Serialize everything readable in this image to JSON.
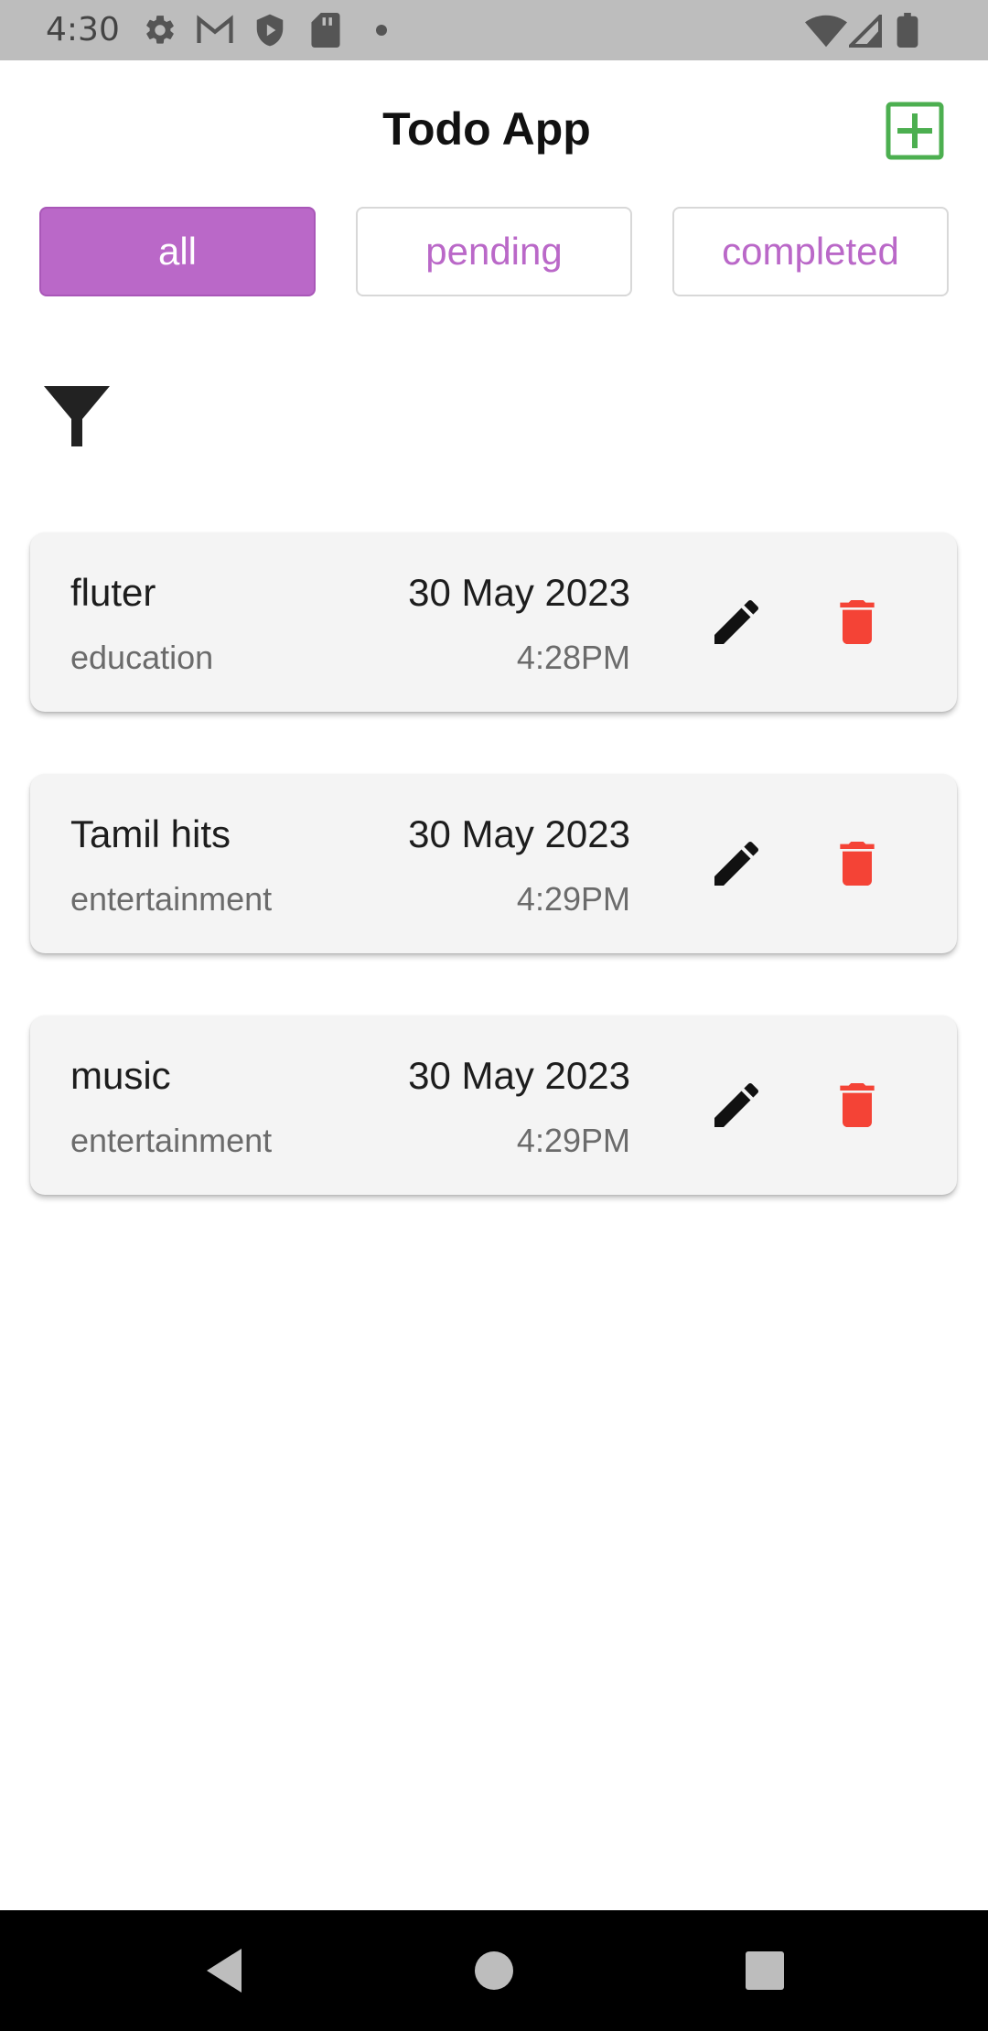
{
  "status_bar": {
    "time": "4:30",
    "icons": [
      "settings-icon",
      "gmail-icon",
      "shield-icon",
      "sd-card-icon",
      "dot-icon",
      "wifi-icon",
      "signal-icon",
      "battery-icon"
    ]
  },
  "header": {
    "title": "Todo App",
    "add_icon": "add-box-icon",
    "add_color": "#4caf50"
  },
  "tabs": [
    {
      "label": "all",
      "active": true
    },
    {
      "label": "pending",
      "active": false
    },
    {
      "label": "completed",
      "active": false
    }
  ],
  "accent_color": "#ba68c8",
  "filter_icon": "filter-icon",
  "todos": [
    {
      "title": "fluter",
      "category": "education",
      "date": "30 May 2023",
      "time": "4:28PM"
    },
    {
      "title": "Tamil hits",
      "category": "entertainment",
      "date": "30 May 2023",
      "time": "4:29PM"
    },
    {
      "title": "music",
      "category": "entertainment",
      "date": "30 May 2023",
      "time": "4:29PM"
    }
  ],
  "delete_color": "#f44336",
  "nav_bar": {
    "icons": [
      "back-icon",
      "home-icon",
      "recents-icon"
    ]
  }
}
